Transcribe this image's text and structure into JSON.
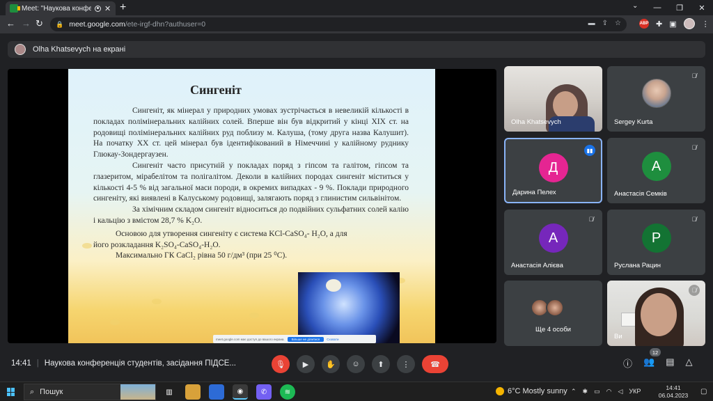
{
  "browser": {
    "tab_title": "Meet: \"Наукова конференц",
    "url_host": "meet.google.com",
    "url_path": "/ete-irgf-dhn?authuser=0"
  },
  "meet": {
    "presenter_banner": "Olha Khatsevych на екрані",
    "slide": {
      "title": "Сингеніт",
      "paragraphs": [
        "Сингеніт, як мінерал у природних умовах зустрічається в невеликій кількості в покладах полімінеральних калійних солей. Вперше він був відкритий у кінці XIX ст. на родовищі полімінеральних калійних руд поблизу м. Калуша, (тому друга назва Калушит). На початку XX ст. цей мінерал був ідентифікований в Німеччині у калійному руднику Глюкау-Зондергаузен.",
        "Сингеніт часто присутній у покладах поряд з гіпсом та галітом, гіпсом та глазеритом, мірабелітом та полігалітом. Деколи в калійних породах сингеніт міститься у кількості 4-5 % від загальної маси породи, в окремих випадках - 9 %. Поклади природного сингеніту, які виявлені в Калуському родовищі, залягають поряд з глинистим сильвінітом.",
        "За хімічним складом сингеніт відноситься до подвійних сульфатних солей калію і кальцію з вмістом 28,7 % K₂O."
      ],
      "para4_line1": "Основою для утворення сингеніту є система KCl-CaSO₄- H₂O, а для",
      "para4_line2": "його розкладання K₂SO₄-CaSO₄-H₂O.",
      "para4_line3": "Максимально ГК CaCl₂ рівна 50 г/дм³ (при 25 ⁰С).",
      "share_notice": "meet.google.com має доступ до вашого екрана.",
      "share_stop": "Більше не ділитися",
      "share_hide": "Сховати"
    },
    "tiles": [
      {
        "name": "Olha Khatsevych"
      },
      {
        "name": "Sergey Kurta"
      },
      {
        "name": "Дарина Пелех",
        "initial": "Д",
        "color": "#e52592"
      },
      {
        "name": "Анастасія Семків",
        "initial": "А",
        "color": "#1e8e3e"
      },
      {
        "name": "Анастасія Алієва",
        "initial": "А",
        "color": "#7627bb"
      },
      {
        "name": "Руслана Рацин",
        "initial": "Р",
        "color": "#137333"
      },
      {
        "name": "Ще 4 особи"
      },
      {
        "name": "Ви"
      }
    ],
    "bottom": {
      "time": "14:41",
      "meeting_title": "Наукова конференція студентів, засідання ПІДСЕ...",
      "participants_count": "12"
    }
  },
  "taskbar": {
    "search_label": "Пошук",
    "weather": "6°C  Mostly sunny",
    "lang": "УКР",
    "time": "14:41",
    "date": "06.04.2023"
  }
}
